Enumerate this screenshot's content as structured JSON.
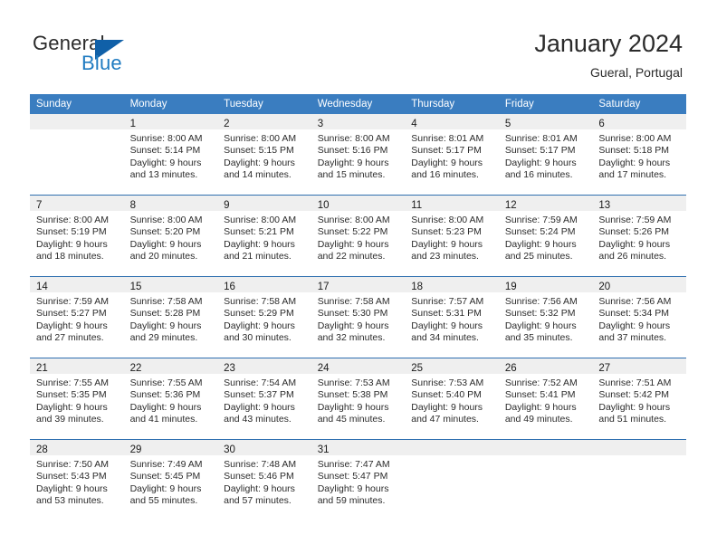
{
  "brand": {
    "name_top": "General",
    "name_bottom": "Blue",
    "triangle_icon": "triangle-icon",
    "colors": {
      "dark": "#2b2b2b",
      "blue": "#1f7bc1",
      "triangle": "#1060a8"
    }
  },
  "header": {
    "title": "January 2024",
    "subtitle": "Gueral, Portugal"
  },
  "theme": {
    "header_row_bg": "#3a7dc0",
    "row_separator": "#2f6fb0",
    "daynum_band_bg": "#efefef",
    "text": "#2b2b2b"
  },
  "weekday_headers": [
    "Sunday",
    "Monday",
    "Tuesday",
    "Wednesday",
    "Thursday",
    "Friday",
    "Saturday"
  ],
  "weeks": [
    [
      {
        "day": "",
        "lines": []
      },
      {
        "day": "1",
        "lines": [
          "Sunrise: 8:00 AM",
          "Sunset: 5:14 PM",
          "Daylight: 9 hours",
          "and 13 minutes."
        ]
      },
      {
        "day": "2",
        "lines": [
          "Sunrise: 8:00 AM",
          "Sunset: 5:15 PM",
          "Daylight: 9 hours",
          "and 14 minutes."
        ]
      },
      {
        "day": "3",
        "lines": [
          "Sunrise: 8:00 AM",
          "Sunset: 5:16 PM",
          "Daylight: 9 hours",
          "and 15 minutes."
        ]
      },
      {
        "day": "4",
        "lines": [
          "Sunrise: 8:01 AM",
          "Sunset: 5:17 PM",
          "Daylight: 9 hours",
          "and 16 minutes."
        ]
      },
      {
        "day": "5",
        "lines": [
          "Sunrise: 8:01 AM",
          "Sunset: 5:17 PM",
          "Daylight: 9 hours",
          "and 16 minutes."
        ]
      },
      {
        "day": "6",
        "lines": [
          "Sunrise: 8:00 AM",
          "Sunset: 5:18 PM",
          "Daylight: 9 hours",
          "and 17 minutes."
        ]
      }
    ],
    [
      {
        "day": "7",
        "lines": [
          "Sunrise: 8:00 AM",
          "Sunset: 5:19 PM",
          "Daylight: 9 hours",
          "and 18 minutes."
        ]
      },
      {
        "day": "8",
        "lines": [
          "Sunrise: 8:00 AM",
          "Sunset: 5:20 PM",
          "Daylight: 9 hours",
          "and 20 minutes."
        ]
      },
      {
        "day": "9",
        "lines": [
          "Sunrise: 8:00 AM",
          "Sunset: 5:21 PM",
          "Daylight: 9 hours",
          "and 21 minutes."
        ]
      },
      {
        "day": "10",
        "lines": [
          "Sunrise: 8:00 AM",
          "Sunset: 5:22 PM",
          "Daylight: 9 hours",
          "and 22 minutes."
        ]
      },
      {
        "day": "11",
        "lines": [
          "Sunrise: 8:00 AM",
          "Sunset: 5:23 PM",
          "Daylight: 9 hours",
          "and 23 minutes."
        ]
      },
      {
        "day": "12",
        "lines": [
          "Sunrise: 7:59 AM",
          "Sunset: 5:24 PM",
          "Daylight: 9 hours",
          "and 25 minutes."
        ]
      },
      {
        "day": "13",
        "lines": [
          "Sunrise: 7:59 AM",
          "Sunset: 5:26 PM",
          "Daylight: 9 hours",
          "and 26 minutes."
        ]
      }
    ],
    [
      {
        "day": "14",
        "lines": [
          "Sunrise: 7:59 AM",
          "Sunset: 5:27 PM",
          "Daylight: 9 hours",
          "and 27 minutes."
        ]
      },
      {
        "day": "15",
        "lines": [
          "Sunrise: 7:58 AM",
          "Sunset: 5:28 PM",
          "Daylight: 9 hours",
          "and 29 minutes."
        ]
      },
      {
        "day": "16",
        "lines": [
          "Sunrise: 7:58 AM",
          "Sunset: 5:29 PM",
          "Daylight: 9 hours",
          "and 30 minutes."
        ]
      },
      {
        "day": "17",
        "lines": [
          "Sunrise: 7:58 AM",
          "Sunset: 5:30 PM",
          "Daylight: 9 hours",
          "and 32 minutes."
        ]
      },
      {
        "day": "18",
        "lines": [
          "Sunrise: 7:57 AM",
          "Sunset: 5:31 PM",
          "Daylight: 9 hours",
          "and 34 minutes."
        ]
      },
      {
        "day": "19",
        "lines": [
          "Sunrise: 7:56 AM",
          "Sunset: 5:32 PM",
          "Daylight: 9 hours",
          "and 35 minutes."
        ]
      },
      {
        "day": "20",
        "lines": [
          "Sunrise: 7:56 AM",
          "Sunset: 5:34 PM",
          "Daylight: 9 hours",
          "and 37 minutes."
        ]
      }
    ],
    [
      {
        "day": "21",
        "lines": [
          "Sunrise: 7:55 AM",
          "Sunset: 5:35 PM",
          "Daylight: 9 hours",
          "and 39 minutes."
        ]
      },
      {
        "day": "22",
        "lines": [
          "Sunrise: 7:55 AM",
          "Sunset: 5:36 PM",
          "Daylight: 9 hours",
          "and 41 minutes."
        ]
      },
      {
        "day": "23",
        "lines": [
          "Sunrise: 7:54 AM",
          "Sunset: 5:37 PM",
          "Daylight: 9 hours",
          "and 43 minutes."
        ]
      },
      {
        "day": "24",
        "lines": [
          "Sunrise: 7:53 AM",
          "Sunset: 5:38 PM",
          "Daylight: 9 hours",
          "and 45 minutes."
        ]
      },
      {
        "day": "25",
        "lines": [
          "Sunrise: 7:53 AM",
          "Sunset: 5:40 PM",
          "Daylight: 9 hours",
          "and 47 minutes."
        ]
      },
      {
        "day": "26",
        "lines": [
          "Sunrise: 7:52 AM",
          "Sunset: 5:41 PM",
          "Daylight: 9 hours",
          "and 49 minutes."
        ]
      },
      {
        "day": "27",
        "lines": [
          "Sunrise: 7:51 AM",
          "Sunset: 5:42 PM",
          "Daylight: 9 hours",
          "and 51 minutes."
        ]
      }
    ],
    [
      {
        "day": "28",
        "lines": [
          "Sunrise: 7:50 AM",
          "Sunset: 5:43 PM",
          "Daylight: 9 hours",
          "and 53 minutes."
        ]
      },
      {
        "day": "29",
        "lines": [
          "Sunrise: 7:49 AM",
          "Sunset: 5:45 PM",
          "Daylight: 9 hours",
          "and 55 minutes."
        ]
      },
      {
        "day": "30",
        "lines": [
          "Sunrise: 7:48 AM",
          "Sunset: 5:46 PM",
          "Daylight: 9 hours",
          "and 57 minutes."
        ]
      },
      {
        "day": "31",
        "lines": [
          "Sunrise: 7:47 AM",
          "Sunset: 5:47 PM",
          "Daylight: 9 hours",
          "and 59 minutes."
        ]
      },
      {
        "day": "",
        "lines": []
      },
      {
        "day": "",
        "lines": []
      },
      {
        "day": "",
        "lines": []
      }
    ]
  ]
}
